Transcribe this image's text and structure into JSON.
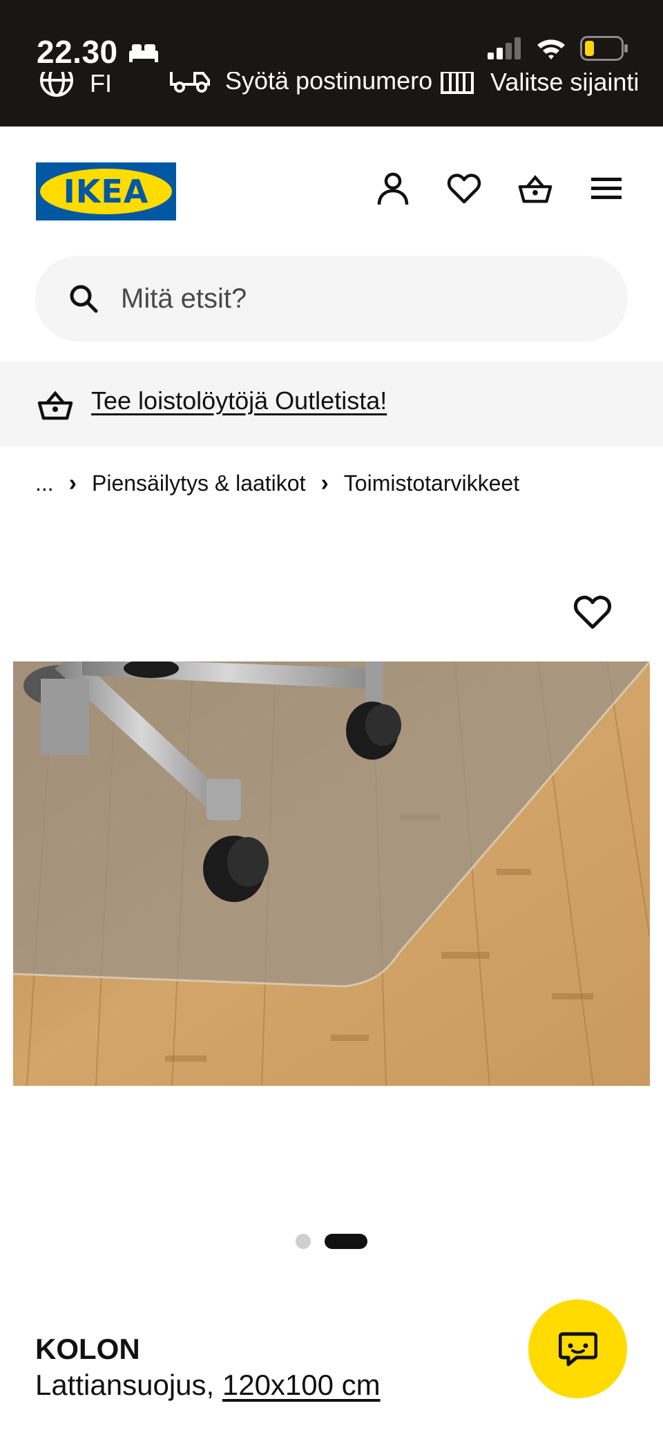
{
  "status_bar": {
    "time": "22.30",
    "bed_icon": "bed-icon",
    "signal_icon": "cellular-signal-icon",
    "wifi_icon": "wifi-icon",
    "battery_icon": "battery-low-icon",
    "battery_color": "#ffd60a"
  },
  "top_strip": {
    "items": [
      {
        "icon": "globe-icon",
        "label": "FI"
      },
      {
        "icon": "truck-icon",
        "label": "Syötä postinumero"
      },
      {
        "icon": "store-icon",
        "label": "Valitse sijainti"
      }
    ]
  },
  "header": {
    "logo_text": "IKEA",
    "brand_blue": "#0058a3",
    "brand_yellow": "#ffdb00",
    "icons": [
      "user-icon",
      "heart-icon",
      "basket-icon",
      "menu-icon"
    ]
  },
  "search": {
    "placeholder": "Mitä etsit?"
  },
  "promo": {
    "icon": "basket-icon",
    "link_text": "Tee loistolöytöjä Outletista!"
  },
  "breadcrumb": {
    "ellipsis": "...",
    "items": [
      "Piensäilytys & laatikot",
      "Toimistotarvikkeet"
    ]
  },
  "product": {
    "name": "KOLON",
    "type": "Lattiansuojus,",
    "size": "120x100 cm",
    "image_index": 2,
    "image_count": 2
  },
  "chat": {
    "icon": "chat-icon",
    "color": "#ffdb00"
  }
}
